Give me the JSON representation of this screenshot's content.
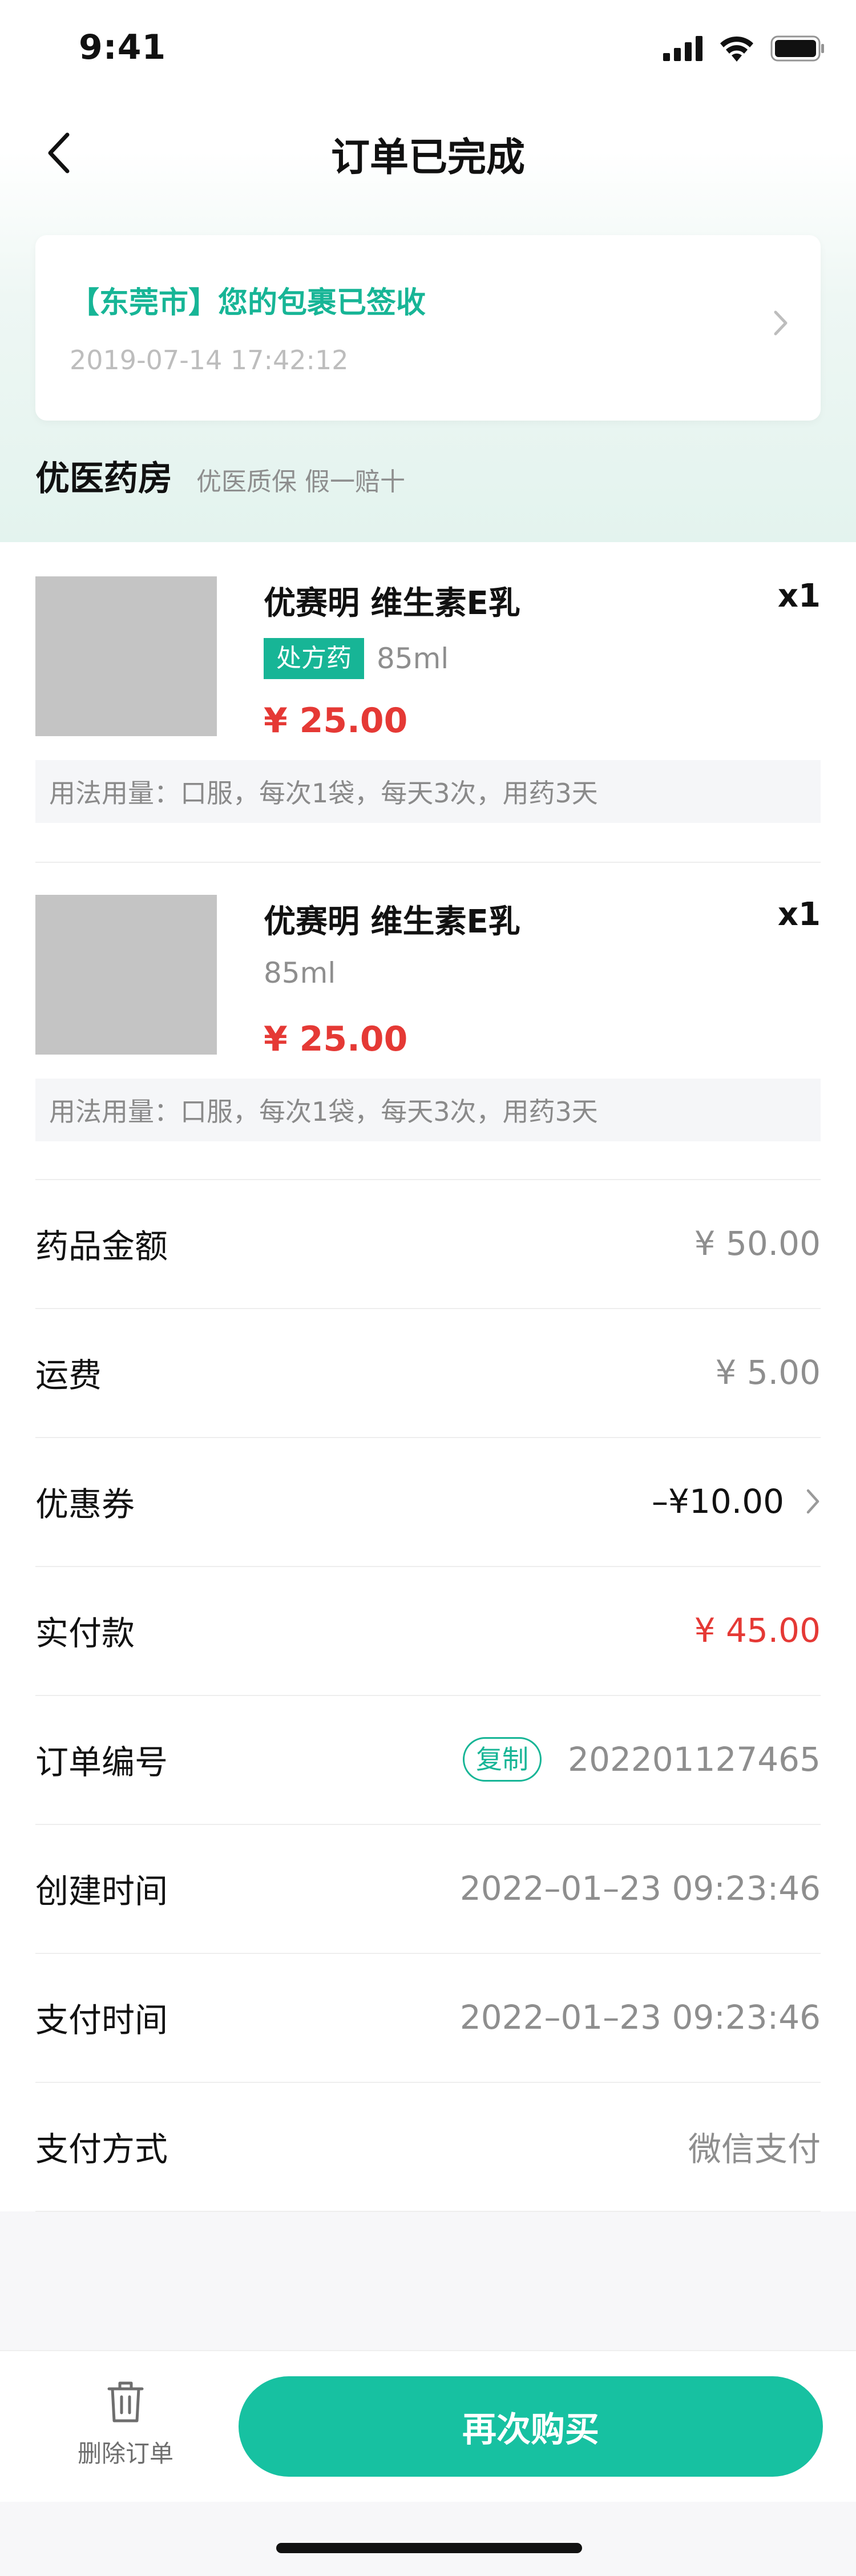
{
  "status_bar": {
    "time": "9:41"
  },
  "nav": {
    "title": "订单已完成"
  },
  "logistics": {
    "message": "【东莞市】您的包裹已签收",
    "time": "2019-07-14  17:42:12"
  },
  "store": {
    "name": "优医药房",
    "tags": "优医质保 假一赔十"
  },
  "products": [
    {
      "name": "优赛明 维生素E乳",
      "qty": "x1",
      "tag": "处方药",
      "spec": "85ml",
      "price": "¥ 25.00",
      "usage": "用法用量：口服，每次1袋，每天3次，用药3天"
    },
    {
      "name": "优赛明 维生素E乳",
      "qty": "x1",
      "tag": "",
      "spec": "85ml",
      "price": "¥ 25.00",
      "usage": "用法用量：口服，每次1袋，每天3次，用药3天"
    }
  ],
  "summary": {
    "drug_amount_label": "药品金额",
    "drug_amount_value": "¥ 50.00",
    "shipping_label": "运费",
    "shipping_value": "¥ 5.00",
    "coupon_label": "优惠券",
    "coupon_value": "–¥10.00",
    "paid_label": "实付款",
    "paid_value": "¥ 45.00",
    "order_no_label": "订单编号",
    "copy_label": "复制",
    "order_no_value": "202201127465",
    "created_label": "创建时间",
    "created_value": "2022–01–23 09:23:46",
    "pay_time_label": "支付时间",
    "pay_time_value": "2022–01–23 09:23:46",
    "pay_method_label": "支付方式",
    "pay_method_value": "微信支付"
  },
  "actions": {
    "delete_label": "删除订单",
    "rebuy_label": "再次购买"
  },
  "colors": {
    "accent": "#17B596",
    "button": "#17C1A1",
    "price": "#E53935"
  }
}
